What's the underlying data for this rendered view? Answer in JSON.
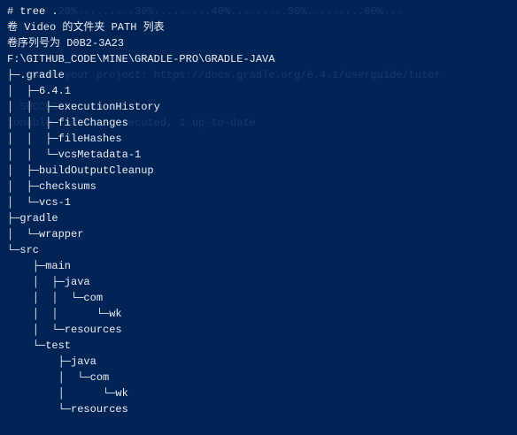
{
  "terminal": {
    "background": "#012456",
    "foreground": "#eeedf0",
    "ghost_lines": [
      "        20%.........30%.........40%.........50%.........60%...",
      "    with your project: https://docs.gradle.org/6.4.1/userguide/tutor",
      "  SUCCESSFUL in 1s",
      "ionable tasks: 1 executed, 1 up-to-date"
    ],
    "lines": [
      "# tree .",
      "卷 Video 的文件夹 PATH 列表",
      "卷序列号为 D0B2-3A23",
      "F:\\GITHUB_CODE\\MINE\\GRADLE-PRO\\GRADLE-JAVA",
      "├─.gradle",
      "│  ├─6.4.1",
      "│  │  ├─executionHistory",
      "│  │  ├─fileChanges",
      "│  │  ├─fileHashes",
      "│  │  └─vcsMetadata-1",
      "│  ├─buildOutputCleanup",
      "│  ├─checksums",
      "│  └─vcs-1",
      "├─gradle",
      "│  └─wrapper",
      "└─src",
      "    ├─main",
      "    │  ├─java",
      "    │  │  └─com",
      "    │  │      └─wk",
      "    │  └─resources",
      "    └─test",
      "        ├─java",
      "        │  └─com",
      "        │      └─wk",
      "        └─resources"
    ]
  }
}
